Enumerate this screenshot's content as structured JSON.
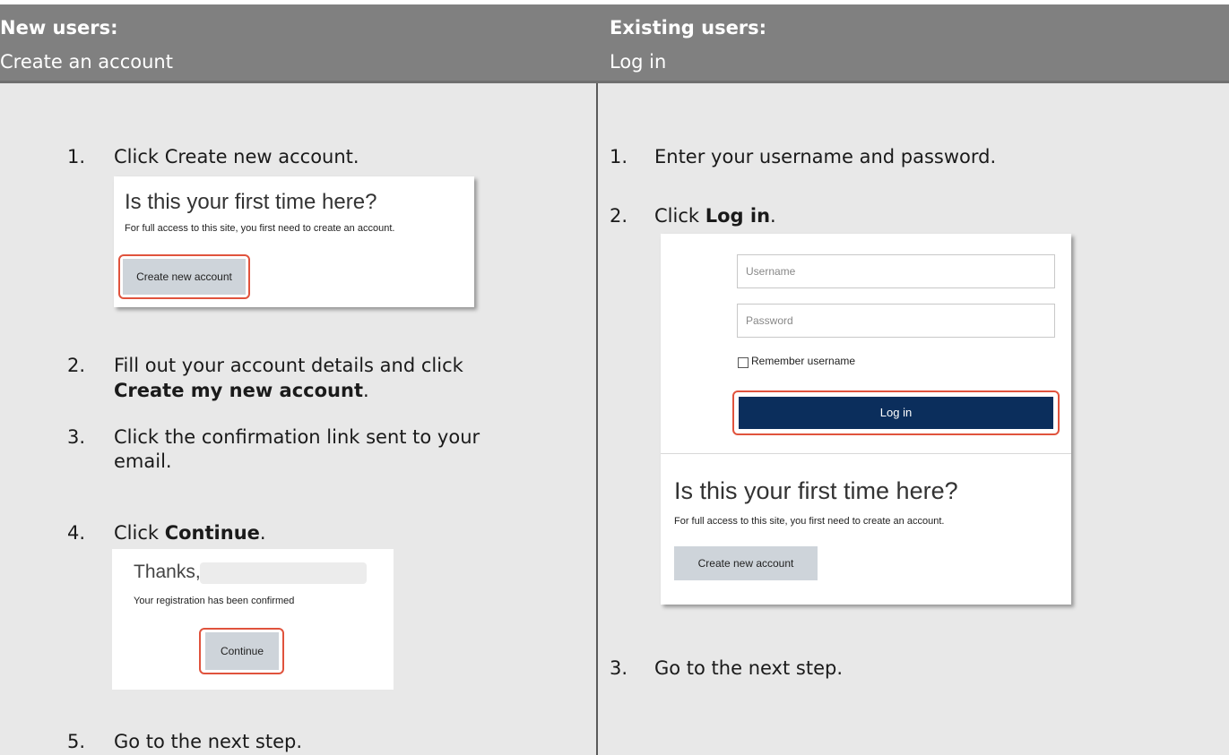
{
  "header": {
    "left": {
      "title": "New users:",
      "subtitle": "Create an account"
    },
    "right": {
      "title": "Existing users:",
      "subtitle": "Log in"
    }
  },
  "new_users": {
    "steps": [
      {
        "num": "1.",
        "text": "Click Create new account."
      },
      {
        "num": "2.",
        "text_pre": "Fill out your account details and click",
        "text_bold": "Create my new account",
        "text_post": "."
      },
      {
        "num": "3.",
        "text_line1": "Click the confirmation link sent to your",
        "text_line2": "email."
      },
      {
        "num": "4.",
        "text_pre": "Click ",
        "text_bold": "Continue",
        "text_post": "."
      },
      {
        "num": "5.",
        "text": "Go to the next step."
      }
    ],
    "screenshot_first_time": {
      "heading": "Is this your first time here?",
      "description": "For full access to this site, you first need to create an account.",
      "button": "Create new account"
    },
    "screenshot_thanks": {
      "heading": "Thanks,",
      "message": "Your registration has been confirmed",
      "button": "Continue"
    }
  },
  "existing_users": {
    "steps": [
      {
        "num": "1.",
        "text": "Enter your username and password."
      },
      {
        "num": "2.",
        "text_pre": "Click ",
        "text_bold": "Log in",
        "text_post": "."
      },
      {
        "num": "3.",
        "text": "Go to the next step."
      }
    ],
    "screenshot_login": {
      "username_placeholder": "Username",
      "password_placeholder": "Password",
      "remember_label": "Remember username",
      "login_button": "Log in",
      "first_time_heading": "Is this your first time here?",
      "first_time_description": "For full access to this site, you first need to create an account.",
      "create_button": "Create new account"
    }
  },
  "colors": {
    "header_bg": "#808080",
    "panel_bg": "#e8e8e8",
    "highlight": "#e0533d",
    "navy": "#0b2e5c"
  }
}
